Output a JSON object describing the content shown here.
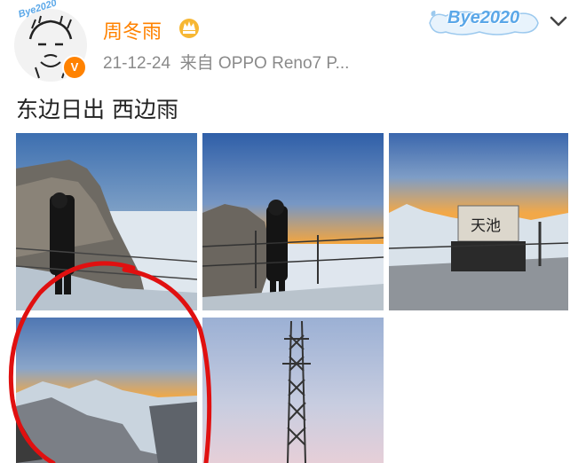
{
  "user": {
    "name": "周冬雨",
    "avatar_tag": "Bye2020",
    "verified_badge": "V"
  },
  "meta": {
    "date": "21-12-24",
    "source_prefix": "来自",
    "device": "OPPO Reno7 P..."
  },
  "header_tag": "Bye2020",
  "post": {
    "text": "东边日出 西边雨"
  },
  "photos": [
    {
      "subject": "person on rocky cliff at sunset over snow"
    },
    {
      "subject": "person standing by railing at sunset"
    },
    {
      "subject": "stone marker",
      "sign_text": "天池"
    },
    {
      "subject": "snowy mountain landscape at sunset"
    },
    {
      "subject": "steel tower against twilight sky"
    }
  ],
  "colors": {
    "accent": "#ff8200",
    "meta_gray": "#8a8a8a",
    "annotation_red": "#e01010"
  },
  "icons": [
    "crown-icon",
    "chevron-down-icon",
    "verified-badge-icon"
  ]
}
